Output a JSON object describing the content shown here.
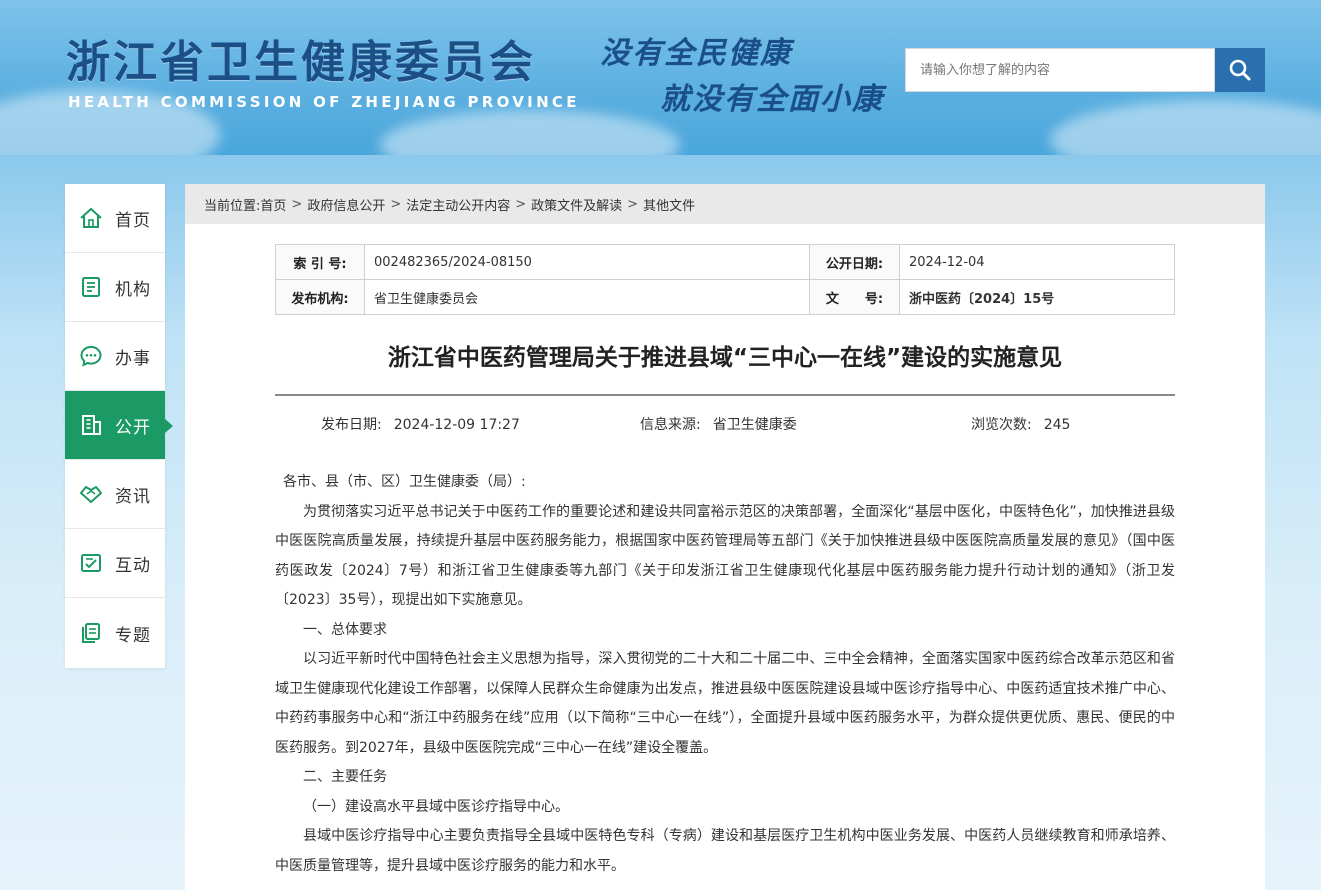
{
  "header": {
    "title": "浙江省卫生健康委员会",
    "subtitle": "HEALTH COMMISSION OF ZHEJIANG PROVINCE",
    "slogan_line1": "没有全民健康",
    "slogan_line2": "就没有全面小康",
    "search_placeholder": "请输入你想了解的内容",
    "search_icon": "search-icon"
  },
  "sidebar": {
    "items": [
      {
        "label": "首页",
        "icon": "home-icon"
      },
      {
        "label": "机构",
        "icon": "org-icon"
      },
      {
        "label": "办事",
        "icon": "chat-icon"
      },
      {
        "label": "公开",
        "icon": "building-icon",
        "active": true
      },
      {
        "label": "资讯",
        "icon": "handshake-icon"
      },
      {
        "label": "互动",
        "icon": "interact-icon"
      },
      {
        "label": "专题",
        "icon": "topic-icon"
      }
    ],
    "accent_color": "#1c9a66"
  },
  "breadcrumb": {
    "prefix": "当前位置:",
    "items": [
      "首页",
      "政府信息公开",
      "法定主动公开内容",
      "政策文件及解读",
      "其他文件"
    ],
    "separator": ">"
  },
  "meta": {
    "index_label": "索 引 号:",
    "index_value": "002482365/2024-08150",
    "open_date_label": "公开日期:",
    "open_date_value": "2024-12-04",
    "issuer_label": "发布机构:",
    "issuer_value": "省卫生健康委员会",
    "docno_label": "文　　号:",
    "docno_value": "浙中医药〔2024〕15号"
  },
  "document": {
    "title": "浙江省中医药管理局关于推进县域“三中心一在线”建设的实施意见",
    "publish_label": "发布日期:",
    "publish_value": "2024-12-09 17:27",
    "source_label": "信息来源:",
    "source_value": "省卫生健康委",
    "views_label": "浏览次数:",
    "views_value": "245",
    "paragraphs": [
      "各市、县（市、区）卫生健康委（局）:",
      "为贯彻落实习近平总书记关于中医药工作的重要论述和建设共同富裕示范区的决策部署，全面深化“基层中医化，中医特色化”，加快推进县级中医医院高质量发展，持续提升基层中医药服务能力，根据国家中医药管理局等五部门《关于加快推进县级中医医院高质量发展的意见》（国中医药医政发〔2024〕7号）和浙江省卫生健康委等九部门《关于印发浙江省卫生健康现代化基层中医药服务能力提升行动计划的通知》（浙卫发〔2023〕35号），现提出如下实施意见。",
      "一、总体要求",
      "以习近平新时代中国特色社会主义思想为指导，深入贯彻党的二十大和二十届二中、三中全会精神，全面落实国家中医药综合改革示范区和省域卫生健康现代化建设工作部署，以保障人民群众生命健康为出发点，推进县级中医医院建设县域中医诊疗指导中心、中医药适宜技术推广中心、中药药事服务中心和“浙江中药服务在线”应用（以下简称“三中心一在线”），全面提升县域中医药服务水平，为群众提供更优质、惠民、便民的中医药服务。到2027年，县级中医医院完成“三中心一在线”建设全覆盖。",
      "二、主要任务",
      "（一）建设高水平县域中医诊疗指导中心。",
      "县域中医诊疗指导中心主要负责指导全县域中医特色专科（专病）建设和基层医疗卫生机构中医业务发展、中医药人员继续教育和师承培养、中医质量管理等，提升县域中医诊疗服务的能力和水平。"
    ]
  }
}
